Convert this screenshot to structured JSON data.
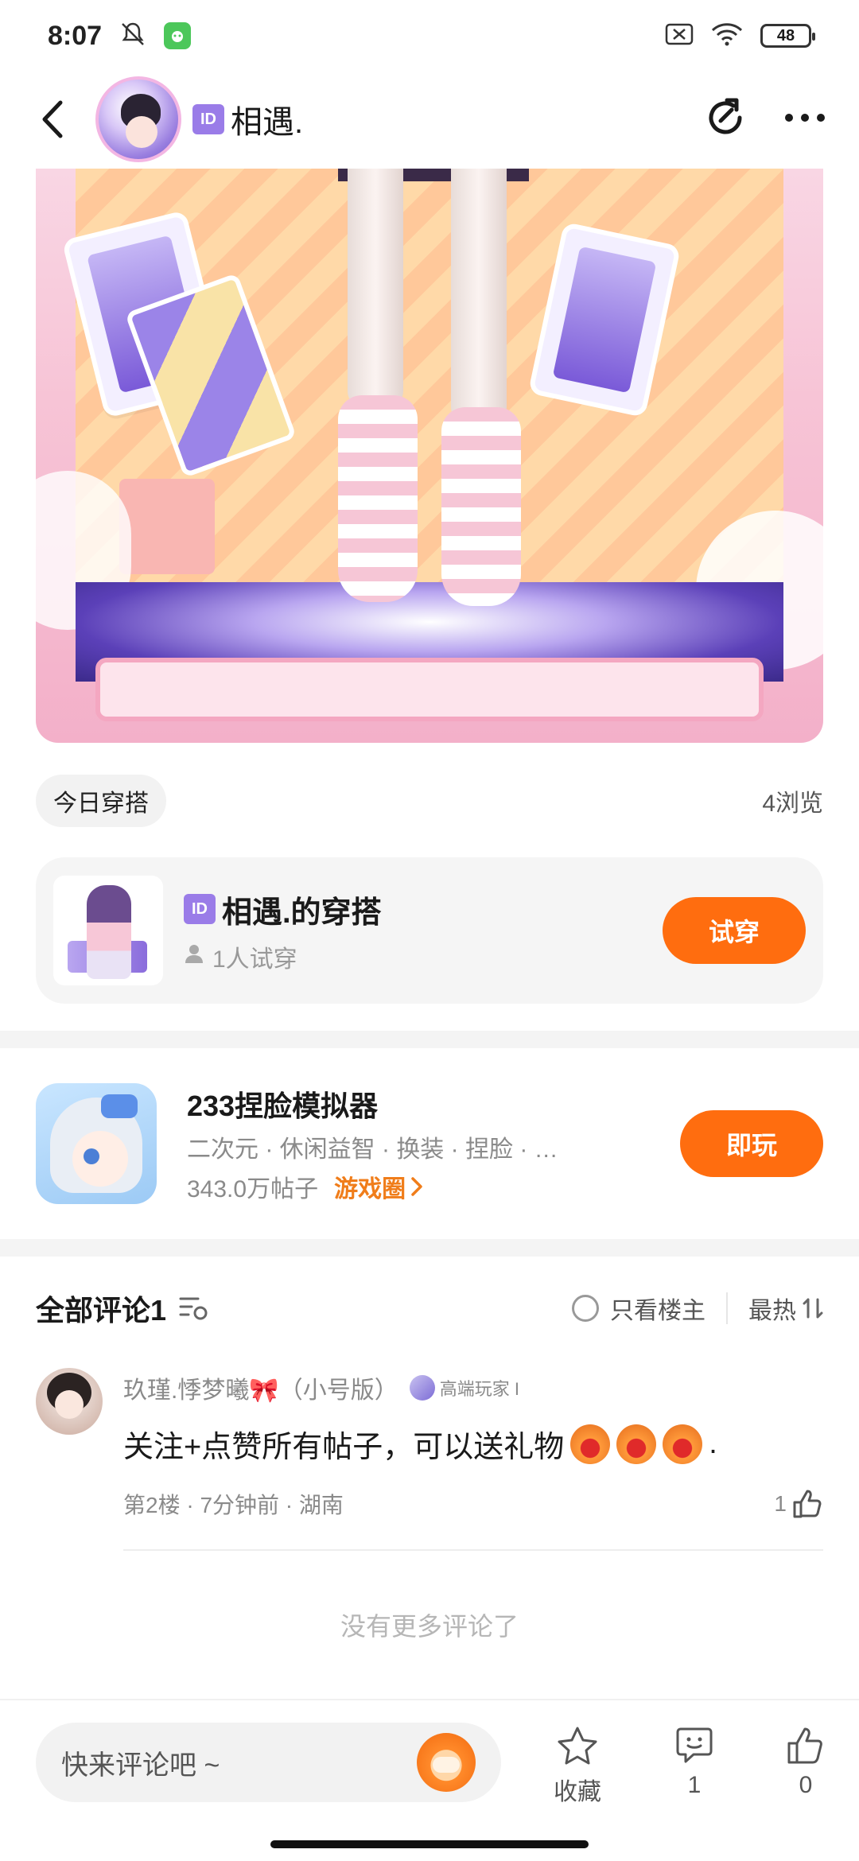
{
  "status_bar": {
    "time": "8:07",
    "battery": "48",
    "icons": [
      "bell-off-icon",
      "app-notification-icon",
      "sim-off-icon",
      "wifi-icon",
      "battery-icon"
    ]
  },
  "header": {
    "id_badge": "ID",
    "title": "相遇.",
    "icons": [
      "back-icon",
      "share-icon",
      "more-icon"
    ]
  },
  "post": {
    "tag": "今日穿搭",
    "views": "4浏览"
  },
  "outfit": {
    "id_badge": "ID",
    "title": "相遇.的穿搭",
    "try_count": "1人试穿",
    "try_button": "试穿"
  },
  "game": {
    "title": "233捏脸模拟器",
    "tags": "二次元 · 休闲益智 · 换装 · 捏脸 · …",
    "posts": "343.0万帖子",
    "circle_link": "游戏圈",
    "play_button": "即玩"
  },
  "comments": {
    "title": "全部评论1",
    "only_owner": "只看楼主",
    "sort": "最热",
    "items": [
      {
        "name": "玖瑾.悸梦曦🎀（小号版）",
        "level": "高端玩家 I",
        "text": "关注+点赞所有帖子，可以送礼物",
        "text_suffix": ".",
        "meta": "第2楼 · 7分钟前 · 湖南",
        "likes": "1"
      }
    ],
    "no_more": "没有更多评论了"
  },
  "bottom_bar": {
    "input_placeholder": "快来评论吧 ~",
    "favorite_label": "收藏",
    "comment_count": "1",
    "like_count": "0"
  },
  "colors": {
    "accent": "#ff6d0f",
    "game_circle": "#f07d1a",
    "id_badge": "#9a7ce8"
  }
}
